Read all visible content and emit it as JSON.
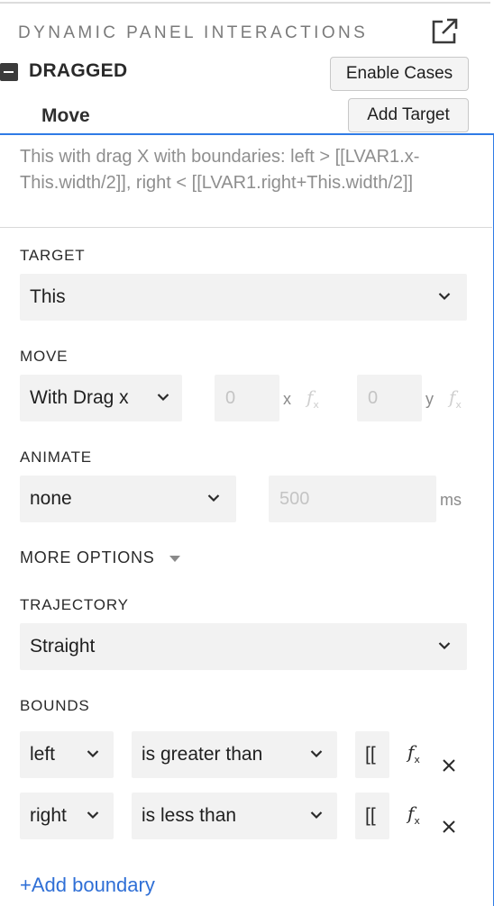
{
  "header": {
    "panel_title": "DYNAMIC PANEL INTERACTIONS",
    "event_title": "DRAGGED",
    "enable_cases_label": "Enable Cases",
    "action_title": "Move",
    "add_target_label": "Add Target"
  },
  "summary": "This with drag X  with boundaries: left > [[LVAR1.x-This.width/2]], right < [[LVAR1.right+This.width/2]]",
  "target": {
    "label": "TARGET",
    "value": "This"
  },
  "move": {
    "label": "MOVE",
    "type_value": "With Drag x",
    "x_placeholder": "0",
    "x_unit": "x",
    "y_placeholder": "0",
    "y_unit": "y",
    "fx_label": "f",
    "fx_sub": "x"
  },
  "animate": {
    "label": "ANIMATE",
    "value": "none",
    "duration_placeholder": "500",
    "unit": "ms"
  },
  "more_options_label": "MORE OPTIONS",
  "trajectory": {
    "label": "TRAJECTORY",
    "value": "Straight"
  },
  "bounds": {
    "label": "BOUNDS",
    "rows": [
      {
        "side": "left",
        "operator": "is greater than",
        "value": "[["
      },
      {
        "side": "right",
        "operator": "is less than",
        "value": "[["
      }
    ],
    "add_label": "+Add boundary"
  },
  "icons": [
    "popout-icon",
    "collapse-icon",
    "chevron-down-icon",
    "fx-icon",
    "close-icon",
    "caret-down-icon"
  ],
  "colors": {
    "accent": "#2f7be6",
    "link": "#2f6fd6",
    "field_bg": "#f2f2f2"
  }
}
